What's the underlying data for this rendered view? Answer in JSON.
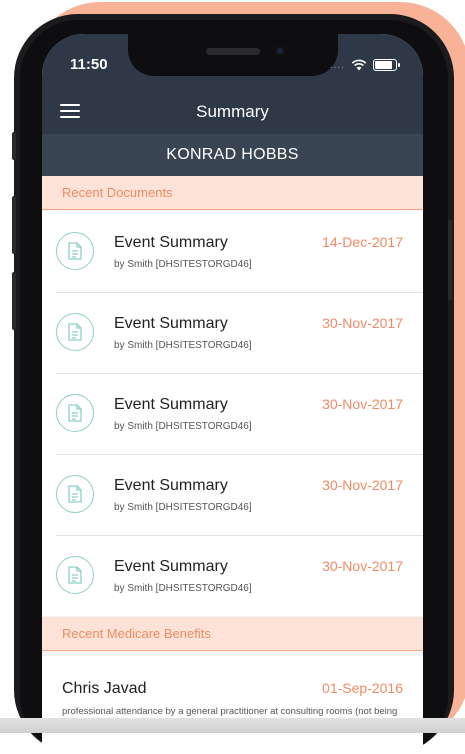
{
  "status_bar": {
    "time": "11:50",
    "signal_dots": "...."
  },
  "navbar": {
    "title": "Summary"
  },
  "patient": {
    "name": "KONRAD HOBBS"
  },
  "recent_documents": {
    "header": "Recent Documents",
    "items": [
      {
        "title": "Event Summary",
        "by": "by Smith [DHSITESTORGD46]",
        "date": "14-Dec-2017"
      },
      {
        "title": "Event Summary",
        "by": "by Smith [DHSITESTORGD46]",
        "date": "30-Nov-2017"
      },
      {
        "title": "Event Summary",
        "by": "by Smith [DHSITESTORGD46]",
        "date": "30-Nov-2017"
      },
      {
        "title": "Event Summary",
        "by": "by Smith [DHSITESTORGD46]",
        "date": "30-Nov-2017"
      },
      {
        "title": "Event Summary",
        "by": "by Smith [DHSITESTORGD46]",
        "date": "30-Nov-2017"
      }
    ]
  },
  "recent_benefits": {
    "header": "Recent Medicare Benefits",
    "items": [
      {
        "name": "Chris Javad",
        "date": "01-Sep-2016",
        "description": "professional attendance by a general practitioner at consulting rooms (not being a service to which any other item in this table..."
      }
    ]
  },
  "colors": {
    "navbar": "#2e3847",
    "accent": "#ef8a65",
    "section_bg": "#fde3d7",
    "icon_ring": "#8fcfca",
    "backdrop": "#f8b297"
  }
}
